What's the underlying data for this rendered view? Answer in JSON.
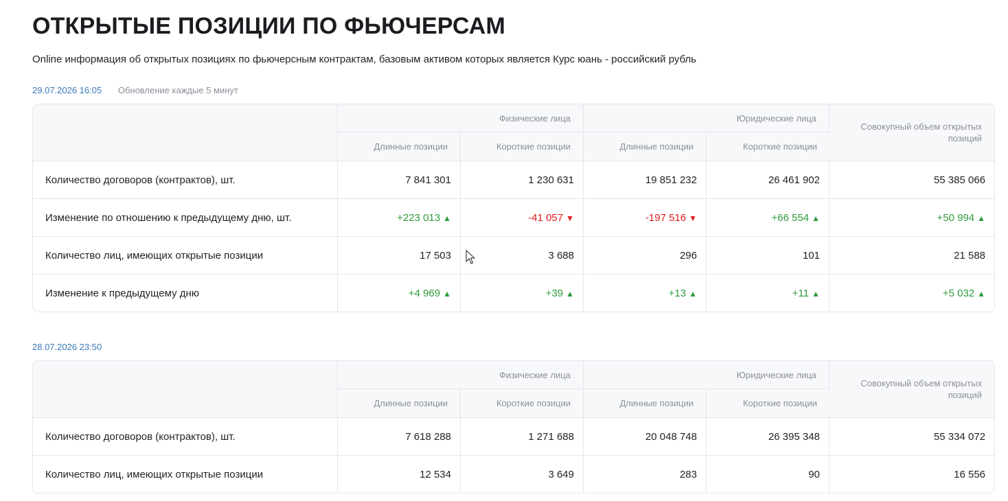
{
  "page": {
    "title": "ОТКРЫТЫЕ ПОЗИЦИИ ПО ФЬЮЧЕРСАМ",
    "subtitle": "Online информация об открытых позициях по фьючерсным контрактам, базовым активом которых является Курс юань - российский рубль"
  },
  "headers": {
    "individuals": "Физические лица",
    "legal": "Юридические лица",
    "long": "Длинные позиции",
    "short": "Короткие позиции",
    "total": "Совокупный объем открытых позиций"
  },
  "colors": {
    "positive": "#2e9a3c",
    "negative": "#e01b1b",
    "date": "#3a78b8"
  },
  "blocks": [
    {
      "date": "29.07.2026 16:05",
      "update_note": "Обновление каждые 5 минут",
      "rows": [
        {
          "label": "Количество договоров (контрактов), шт.",
          "cells": [
            {
              "v": "7 841 301"
            },
            {
              "v": "1 230 631"
            },
            {
              "v": "19 851 232"
            },
            {
              "v": "26 461 902"
            },
            {
              "v": "55 385 066"
            }
          ]
        },
        {
          "label": "Изменение по отношению к предыдущему дню, шт.",
          "cells": [
            {
              "v": "+223 013",
              "dir": "up"
            },
            {
              "v": "-41 057",
              "dir": "down"
            },
            {
              "v": "-197 516",
              "dir": "down"
            },
            {
              "v": "+66 554",
              "dir": "up"
            },
            {
              "v": "+50 994",
              "dir": "up"
            }
          ]
        },
        {
          "label": "Количество лиц, имеющих открытые позиции",
          "cells": [
            {
              "v": "17 503"
            },
            {
              "v": "3 688"
            },
            {
              "v": "296"
            },
            {
              "v": "101"
            },
            {
              "v": "21 588"
            }
          ]
        },
        {
          "label": "Изменение к предыдущему дню",
          "cells": [
            {
              "v": "+4 969",
              "dir": "up"
            },
            {
              "v": "+39",
              "dir": "up"
            },
            {
              "v": "+13",
              "dir": "up"
            },
            {
              "v": "+11",
              "dir": "up"
            },
            {
              "v": "+5 032",
              "dir": "up"
            }
          ]
        }
      ]
    },
    {
      "date": "28.07.2026 23:50",
      "update_note": "",
      "rows": [
        {
          "label": "Количество договоров (контрактов), шт.",
          "cells": [
            {
              "v": "7 618 288"
            },
            {
              "v": "1 271 688"
            },
            {
              "v": "20 048 748"
            },
            {
              "v": "26 395 348"
            },
            {
              "v": "55 334 072"
            }
          ]
        },
        {
          "label": "Количество лиц, имеющих открытые позиции",
          "cells": [
            {
              "v": "12 534"
            },
            {
              "v": "3 649"
            },
            {
              "v": "283"
            },
            {
              "v": "90"
            },
            {
              "v": "16 556"
            }
          ]
        }
      ]
    }
  ]
}
